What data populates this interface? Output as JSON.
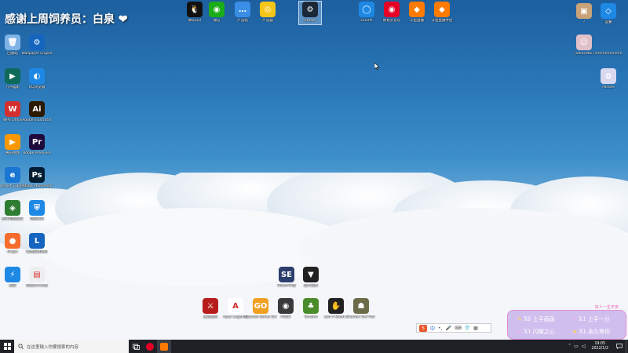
{
  "banner": {
    "text": "感谢上周饲养员：白泉",
    "heart": "❤"
  },
  "top_icons": [
    {
      "label": "腾讯QQ",
      "icon": "qq-icon",
      "color": "#111111",
      "glyph": "🐧"
    },
    {
      "label": "微信",
      "icon": "wechat-icon",
      "color": "#1aad19",
      "glyph": "◉"
    },
    {
      "label": "严选站",
      "icon": "chat-bubble-icon",
      "color": "#3a8ee6",
      "glyph": "…"
    },
    {
      "label": "严选器",
      "icon": "owl-icon",
      "color": "#f5c518",
      "glyph": "◎"
    },
    {
      "label": "Steam",
      "icon": "steam-icon",
      "color": "#1b2838",
      "glyph": "⚙"
    },
    {
      "label": "GOLPA",
      "icon": "golpa-icon",
      "color": "#1e88e5",
      "glyph": "◯"
    },
    {
      "label": "网易云音乐",
      "icon": "netease-music-icon",
      "color": "#e60026",
      "glyph": "◉"
    },
    {
      "label": "斗鱼直播",
      "icon": "douyu-icon",
      "color": "#ff7a00",
      "glyph": "◆"
    },
    {
      "label": "斗鱼直播伴侣",
      "icon": "douyu-companion-icon",
      "color": "#ff7a00",
      "glyph": "◆"
    }
  ],
  "left_icons": [
    {
      "label": "回收站",
      "icon": "recycle-bin-icon",
      "color": "#7fb3e6",
      "glyph": "🗑"
    },
    {
      "label": "Wallpaper Engine",
      "icon": "wallpaper-engine-icon",
      "color": "#1565c0",
      "glyph": "⚙"
    },
    {
      "label": "万兴喵影",
      "icon": "filmora-icon",
      "color": "#0e6b5a",
      "glyph": "▶"
    },
    {
      "label": "QQ浏览器",
      "icon": "qq-browser-icon",
      "color": "#1e88e5",
      "glyph": "◐"
    },
    {
      "label": "WPS Office",
      "icon": "wps-icon",
      "color": "#d32f2f",
      "glyph": "W"
    },
    {
      "label": "Adobe Illustrator",
      "icon": "adobe-illustrator-icon",
      "color": "#2b1a00",
      "glyph": "Ai"
    },
    {
      "label": "腾讯视频",
      "icon": "tencent-video-icon",
      "color": "#ff9800",
      "glyph": "▶"
    },
    {
      "label": "Adobe Premiere",
      "icon": "adobe-premiere-icon",
      "color": "#1e0a3c",
      "glyph": "Pr"
    },
    {
      "label": "Internet Explorer",
      "icon": "internet-explorer-icon",
      "color": "#1976d2",
      "glyph": "e"
    },
    {
      "label": "Adobe Photoshop",
      "icon": "adobe-photoshop-icon",
      "color": "#001d34",
      "glyph": "Ps"
    },
    {
      "label": "腾讯电脑管家",
      "icon": "pc-manager-icon",
      "color": "#2e7d32",
      "glyph": "◈"
    },
    {
      "label": "电脑管家",
      "icon": "shield-icon",
      "color": "#1e88e5",
      "glyph": "⛨"
    },
    {
      "label": "Origin",
      "icon": "origin-icon",
      "color": "#f56c2d",
      "glyph": "●"
    },
    {
      "label": "联想应用商店",
      "icon": "lenovo-store-icon",
      "color": "#1565c0",
      "glyph": "L"
    },
    {
      "label": "迅雷",
      "icon": "thunder-icon",
      "color": "#1e88e5",
      "glyph": "⚡"
    },
    {
      "label": "新建文本文档",
      "icon": "text-document-icon",
      "color": "#eeeeee",
      "glyph": "▤"
    }
  ],
  "right_icons": [
    {
      "label": "?",
      "icon": "photo-icon",
      "color": "#c9a277",
      "glyph": "▣"
    },
    {
      "label": "蓝叠",
      "icon": "bluestacks-icon",
      "color": "#1e88e5",
      "glyph": "◇"
    },
    {
      "label": "[Stkasd81]",
      "icon": "portrait-icon",
      "color": "#e0c0c8",
      "glyph": "☺"
    },
    {
      "label": "mmmmmmmm",
      "icon": "blank-icon",
      "color": "transparent",
      "glyph": ""
    },
    {
      "label": "Parkite",
      "icon": "anime-character-icon",
      "color": "#d8d8f0",
      "glyph": "✿"
    }
  ],
  "mid_icons": [
    {
      "label": "Steam平台",
      "icon": "steam-file-icon",
      "color": "#2c3e6b",
      "glyph": "SE"
    },
    {
      "label": "战术道具",
      "icon": "triangle-game-icon",
      "color": "#222222",
      "glyph": "▼"
    }
  ],
  "game_icons": [
    {
      "label": "永劫无间",
      "icon": "naraka-icon",
      "color": "#b71c1c",
      "glyph": "⚔"
    },
    {
      "label": "Apex Legends",
      "icon": "apex-icon",
      "color": "#ffffff",
      "glyph": "A"
    },
    {
      "label": "Counter-Strike GO",
      "icon": "csgo-icon",
      "color": "#f0a020",
      "glyph": "GO"
    },
    {
      "label": "PUBG",
      "icon": "pubg-icon",
      "color": "#3a3a3a",
      "glyph": "◉"
    },
    {
      "label": "Terraria",
      "icon": "terraria-icon",
      "color": "#4a8c2a",
      "glyph": "♣"
    },
    {
      "label": "Left 4 Dead 2",
      "icon": "left4dead-icon",
      "color": "#222222",
      "glyph": "✋"
    },
    {
      "label": "Human Fall Flat",
      "icon": "game-icon",
      "color": "#6b6b4a",
      "glyph": "☗"
    }
  ],
  "taskbar": {
    "search_placeholder": "在这里输入你要搜索的内容",
    "time": "19:05",
    "date": "2022/1/2"
  },
  "ime": {
    "label": "中"
  },
  "gift_panel": {
    "top": "好人一生平安",
    "row1_left": "X6 上手画画",
    "row1_right": "X1 上手一分",
    "row2_left": "X1 闪耀之心",
    "row2_right": "X1 永久等你"
  }
}
